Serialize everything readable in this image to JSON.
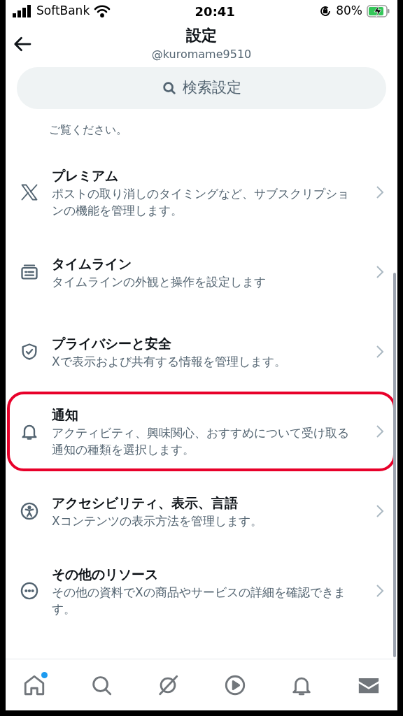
{
  "status_bar": {
    "carrier": "SoftBank",
    "time": "20:41",
    "battery": "80%"
  },
  "header": {
    "title": "設定",
    "handle": "@kuromame9510"
  },
  "search": {
    "placeholder": "検索設定"
  },
  "partial_row": {
    "subtitle": "ご覧ください。"
  },
  "items": [
    {
      "kind": "x",
      "title": "プレミアム",
      "subtitle": "ポストの取り消しのタイミングなど、サブスクリプションの機能を管理します。",
      "highlighted": false
    },
    {
      "kind": "timeline",
      "title": "タイムライン",
      "subtitle": "タイムラインの外観と操作を設定します",
      "highlighted": false
    },
    {
      "kind": "shield",
      "title": "プライバシーと安全",
      "subtitle": "Xで表示および共有する情報を管理します。",
      "highlighted": false
    },
    {
      "kind": "bell",
      "title": "通知",
      "subtitle": "アクティビティ、興味関心、おすすめについて受け取る通知の種類を選択します。",
      "highlighted": true
    },
    {
      "kind": "accessibility",
      "title": "アクセシビリティ、表示、言語",
      "subtitle": "Xコンテンツの表示方法を管理します。",
      "highlighted": false
    },
    {
      "kind": "more",
      "title": "その他のリソース",
      "subtitle": "その他の資料でXの商品やサービスの詳細を確認できます。",
      "highlighted": false
    }
  ],
  "tab_bar": [
    {
      "kind": "home",
      "dot": true
    },
    {
      "kind": "search",
      "dot": false
    },
    {
      "kind": "grok",
      "dot": false
    },
    {
      "kind": "play",
      "dot": false
    },
    {
      "kind": "bell",
      "dot": false
    },
    {
      "kind": "mail",
      "dot": false
    }
  ]
}
